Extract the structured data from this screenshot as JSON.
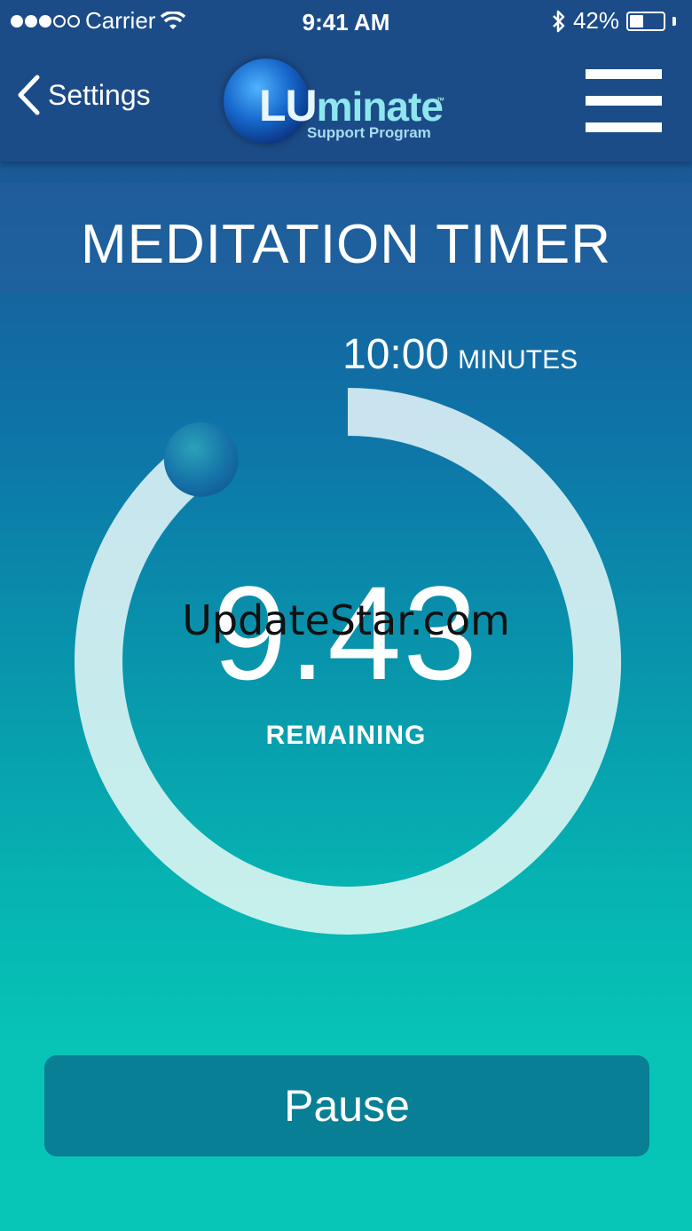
{
  "status_bar": {
    "carrier": "Carrier",
    "time": "9:41 AM",
    "battery": "42%",
    "battery_fraction": 0.42,
    "signal_bars_filled": 3,
    "signal_bars_total": 5,
    "icons": [
      "wifi-icon",
      "bluetooth-icon",
      "battery-icon"
    ]
  },
  "nav": {
    "back_label": "Settings",
    "logo_lu": "LU",
    "logo_rest": "minate",
    "logo_tm": "™",
    "logo_sub": "Support Program",
    "menu_icon": "hamburger-menu-icon"
  },
  "page": {
    "title": "MEDITATION TIMER"
  },
  "timer": {
    "duration_value": "10:00",
    "duration_unit": "MINUTES",
    "remaining": "9.43",
    "remaining_label": "REMAINING",
    "elapsed_fraction": 0.1
  },
  "watermark": "UpdateStar.com",
  "actions": {
    "pause_label": "Pause"
  },
  "colors": {
    "nav_bg": "#1c4c88",
    "ring": "#c8eef0",
    "knob": "#1a7fae",
    "button_bg": "#087f95"
  }
}
